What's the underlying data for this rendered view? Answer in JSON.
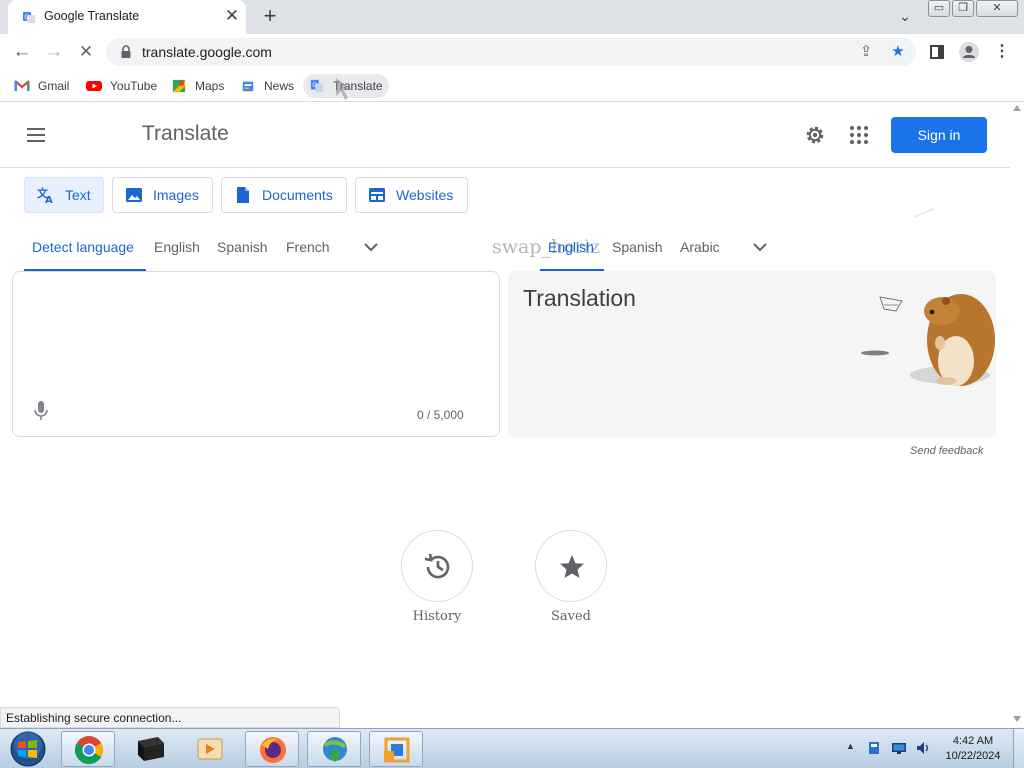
{
  "browser": {
    "tab_title": "Google Translate",
    "url": "translate.google.com",
    "bookmarks": [
      "Gmail",
      "YouTube",
      "Maps",
      "News",
      "Translate"
    ]
  },
  "header": {
    "logo_text": "Translate",
    "signin_label": "Sign in"
  },
  "modes": [
    "Text",
    "Images",
    "Documents",
    "Websites"
  ],
  "source_langs": [
    "Detect language",
    "English",
    "Spanish",
    "French"
  ],
  "target_langs": [
    "English",
    "Spanish",
    "Arabic"
  ],
  "swap_watermark": "swap_horiz",
  "source": {
    "char_count": "0 / 5,000"
  },
  "target": {
    "placeholder": "Translation"
  },
  "feedback": "Send feedback",
  "actions": {
    "history": "History",
    "saved": "Saved"
  },
  "status": "Establishing secure connection...",
  "taskbar": {
    "time": "4:42 AM",
    "date": "10/22/2024"
  }
}
